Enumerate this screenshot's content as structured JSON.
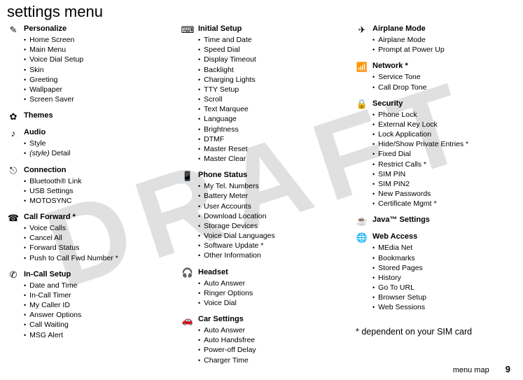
{
  "watermark": "DRAFT",
  "page_title": "settings menu",
  "footer": {
    "section": "menu map",
    "page_number": "9"
  },
  "footnote": "* dependent on your SIM card",
  "columns": [
    [
      {
        "icon": "personalize-icon",
        "title": "Personalize",
        "items": [
          "Home Screen",
          "Main Menu",
          "Voice Dial Setup",
          "Skin",
          "Greeting",
          "Wallpaper",
          "Screen Saver"
        ]
      },
      {
        "icon": "themes-icon",
        "title": "Themes",
        "items": []
      },
      {
        "icon": "audio-icon",
        "title": "Audio",
        "items": [
          "Style"
        ],
        "special_item": {
          "prefix_italic": "(style)",
          "rest": " Detail"
        }
      },
      {
        "icon": "connection-icon",
        "title": "Connection",
        "items": [
          "Bluetooth® Link",
          "USB Settings",
          "MOTOSYNC"
        ]
      },
      {
        "icon": "callforward-icon",
        "title": "Call Forward *",
        "items": [
          "Voice Calls",
          "Cancel All",
          "Forward Status",
          "Push to Call Fwd Number *"
        ]
      },
      {
        "icon": "incall-icon",
        "title": "In-Call Setup",
        "items": [
          "Date and Time",
          "In-Call Timer",
          "My Caller ID",
          "Answer Options",
          "Call Waiting",
          "MSG Alert"
        ]
      }
    ],
    [
      {
        "icon": "initialsetup-icon",
        "title": "Initial Setup",
        "items": [
          "Time and Date",
          "Speed Dial",
          "Display Timeout",
          "Backlight",
          "Charging Lights",
          "TTY Setup",
          "Scroll",
          "Text Marquee",
          "Language",
          "Brightness",
          "DTMF",
          "Master Reset",
          "Master Clear"
        ]
      },
      {
        "icon": "phonestatus-icon",
        "title": "Phone Status",
        "items": [
          "My Tel. Numbers",
          "Battery Meter",
          "User Accounts",
          "Download Location",
          "Storage Devices",
          "Voice Dial Languages",
          "Software Update *",
          "Other Information"
        ]
      },
      {
        "icon": "headset-icon",
        "title": "Headset",
        "items": [
          "Auto Answer",
          "Ringer Options",
          "Voice Dial"
        ]
      },
      {
        "icon": "carsettings-icon",
        "title": "Car Settings",
        "items": [
          "Auto Answer",
          "Auto Handsfree",
          "Power-off Delay",
          "Charger Time"
        ]
      }
    ],
    [
      {
        "icon": "airplane-icon",
        "title": "Airplane Mode",
        "items": [
          "Airplane Mode",
          "Prompt at Power Up"
        ]
      },
      {
        "icon": "network-icon",
        "title": "Network *",
        "items": [
          "Service Tone",
          "Call Drop Tone"
        ]
      },
      {
        "icon": "security-icon",
        "title": "Security",
        "items": [
          "Phone Lock",
          "External Key Lock",
          "Lock Application",
          "Hide/Show Private Entries *",
          "Fixed Dial",
          "Restrict Calls *",
          "SIM PIN",
          "SIM PIN2",
          "New Passwords",
          "Certificate Mgmt *"
        ]
      },
      {
        "icon": "java-icon",
        "title": "Java™ Settings",
        "items": []
      },
      {
        "icon": "webaccess-icon",
        "title": "Web Access",
        "items": [
          "MEdia Net",
          "Bookmarks",
          "Stored Pages",
          "History",
          "Go To URL",
          "Browser Setup",
          "Web Sessions"
        ]
      }
    ]
  ],
  "icons": {
    "personalize-icon": "✎",
    "themes-icon": "✿",
    "audio-icon": "♪",
    "connection-icon": "⎋",
    "callforward-icon": "☎",
    "incall-icon": "✆",
    "initialsetup-icon": "⌨",
    "phonestatus-icon": "📱",
    "headset-icon": "🎧",
    "carsettings-icon": "🚗",
    "airplane-icon": "✈",
    "network-icon": "📶",
    "security-icon": "🔒",
    "java-icon": "☕",
    "webaccess-icon": "🌐"
  }
}
